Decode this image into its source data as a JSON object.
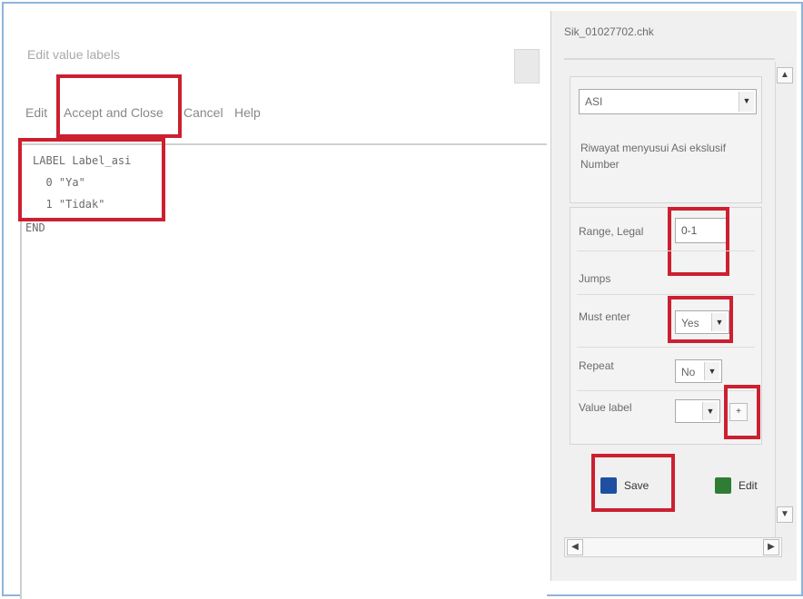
{
  "editor": {
    "title": "Edit value labels",
    "menu": {
      "edit": "Edit",
      "accept_close": "Accept and Close",
      "cancel": "Cancel",
      "help": "Help"
    },
    "code": [
      "LABEL Label_asi",
      "  0 \"Ya\"",
      "  1 \"Tidak\"",
      "END"
    ]
  },
  "panel": {
    "file_title": "Sik_01027702.chk",
    "field_combo": "ASI",
    "description": "Riwayat menyusui Asi ekslusif",
    "description_2": "Number",
    "fields": {
      "range_label": "Range, Legal",
      "range_value": "0-1",
      "jumps_label": "Jumps",
      "must_enter_label": "Must enter",
      "must_enter_value": "Yes",
      "repeat_label": "Repeat",
      "repeat_value": "No",
      "value_label_label": "Value label",
      "value_label_btn": "+"
    },
    "buttons": {
      "save": "Save",
      "edit": "Edit"
    }
  },
  "colors": {
    "highlight": "#cc2030",
    "frame": "#8fb4d9",
    "save_icon": "#1f4fa0",
    "edit_icon": "#2e7d32"
  },
  "icons": {
    "save": "floppy-disk-icon",
    "edit": "edit-icon",
    "dropdown": "chevron-down-icon",
    "scroll_up": "arrow-up-icon",
    "scroll_down": "arrow-down-icon",
    "scroll_left": "arrow-left-icon",
    "scroll_right": "arrow-right-icon"
  }
}
